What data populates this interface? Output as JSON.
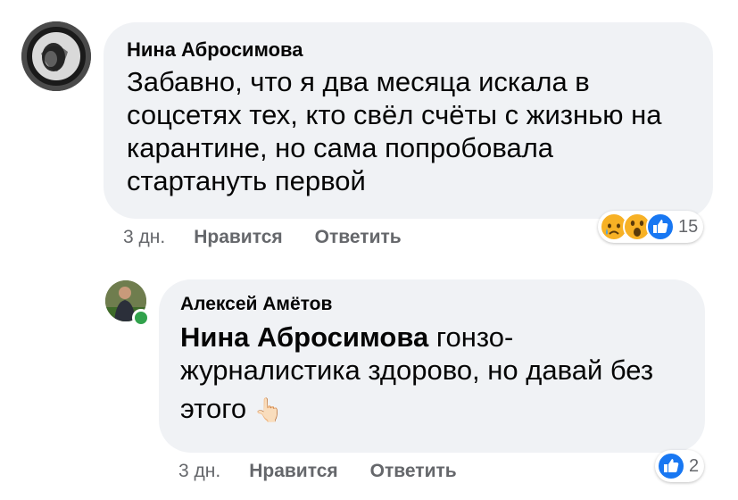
{
  "comments": [
    {
      "author": "Нина Абросимова",
      "lines": [
        "Забавно, что я два месяца искала в",
        "соцсетях тех, кто свёл счёты с жизнью на",
        "карантине, но сама попробовала",
        "стартануть первой"
      ],
      "time": "3 дн.",
      "like_label": "Нравится",
      "reply_label": "Ответить",
      "reactions": {
        "icons": [
          "sad-icon",
          "wow-icon",
          "like-icon"
        ],
        "count": "15"
      }
    },
    {
      "author": "Алексей Амётов",
      "mention": "Нина Абросимова",
      "line1_rest": " гонзо-",
      "line2": "журналистика здорово, но давай без",
      "line3": "этого",
      "emoji": "👆🏻",
      "time": "3 дн.",
      "like_label": "Нравится",
      "reply_label": "Ответить",
      "reactions": {
        "icons": [
          "like-icon"
        ],
        "count": "2"
      }
    }
  ],
  "colors": {
    "bubble": "#f0f2f5",
    "meta": "#65676b",
    "like": "#1877f2",
    "online": "#31a24c"
  }
}
